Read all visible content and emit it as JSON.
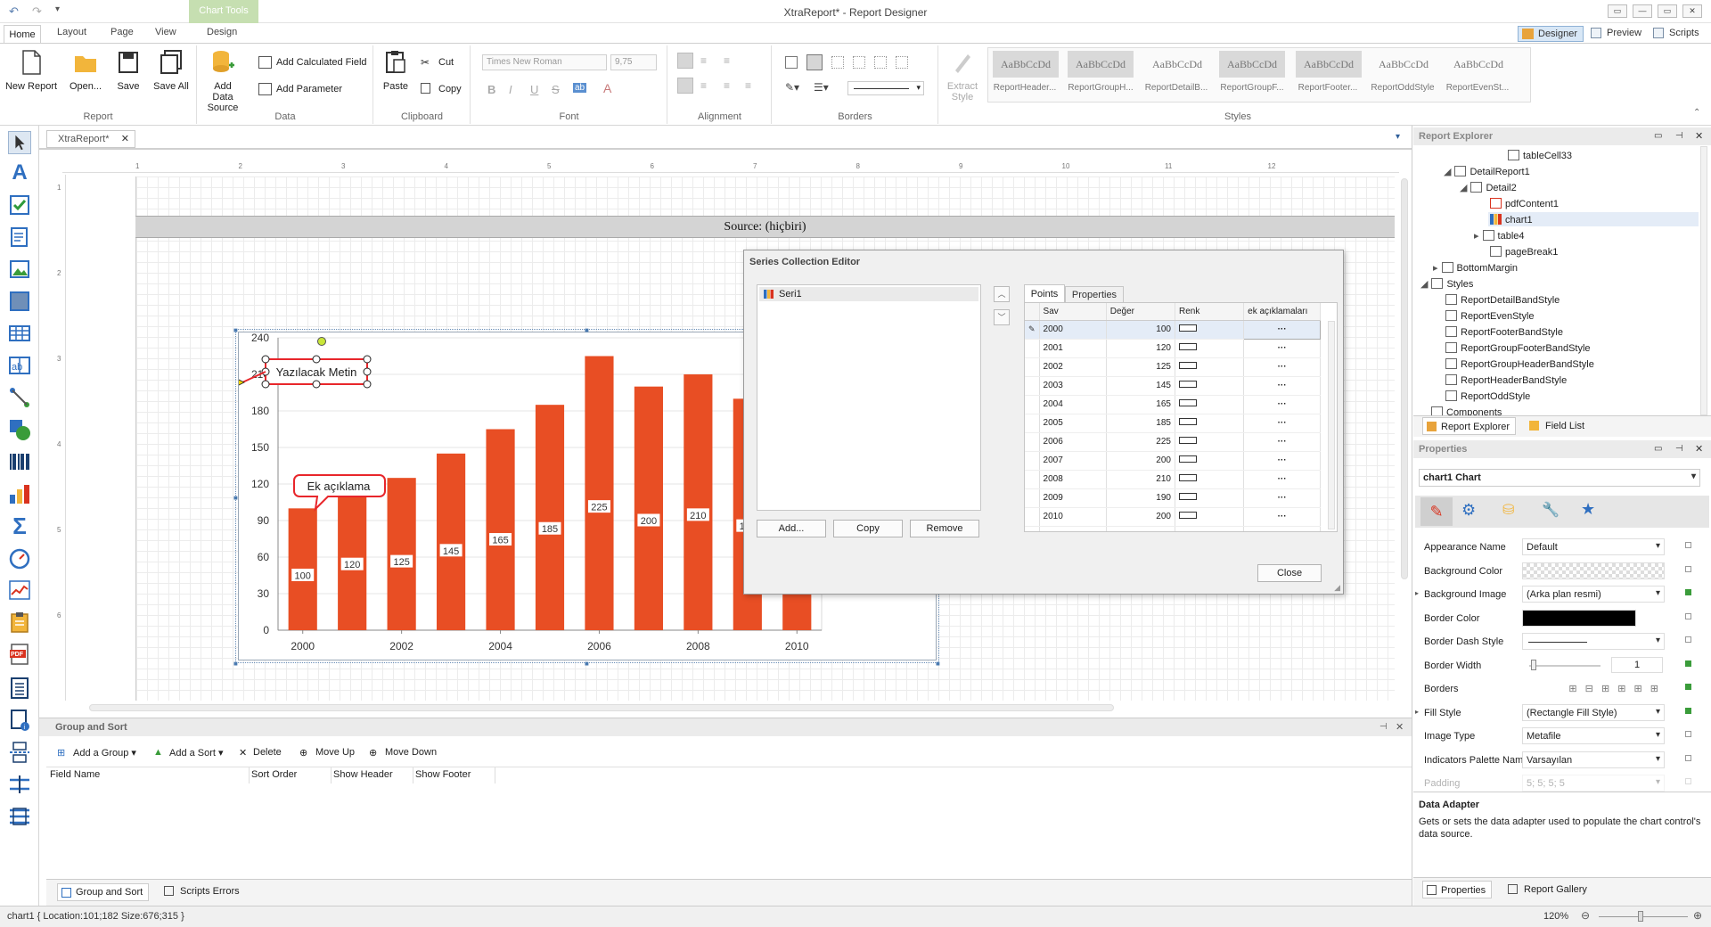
{
  "window": {
    "title": "XtraReport* - Report Designer",
    "contextual_tab": "Chart Tools",
    "controls": [
      "—",
      "▭",
      "▭",
      "✕"
    ]
  },
  "tabs": [
    "Home",
    "Layout",
    "Page",
    "View",
    "Design"
  ],
  "view_buttons": {
    "designer": "Designer",
    "preview": "Preview",
    "scripts": "Scripts"
  },
  "ribbon": {
    "report": {
      "caption": "Report",
      "new": "New Report",
      "open": "Open...",
      "save": "Save",
      "save_all": "Save All"
    },
    "data": {
      "caption": "Data",
      "add_data_source": "Add Data Source",
      "add_calculated": "Add Calculated Field",
      "add_parameter": "Add Parameter"
    },
    "clipboard": {
      "caption": "Clipboard",
      "paste": "Paste",
      "cut": "Cut",
      "copy": "Copy"
    },
    "font": {
      "caption": "Font",
      "family": "Times New Roman",
      "size": "9,75",
      "b": "B",
      "i": "I",
      "u": "U",
      "s": "S",
      "ab": "ab",
      "a": "A"
    },
    "alignment": {
      "caption": "Alignment"
    },
    "borders": {
      "caption": "Borders"
    },
    "styles": {
      "caption": "Styles",
      "extract": "Extract Style",
      "sample": "AaBbCcDd",
      "names": [
        "ReportHeader...",
        "ReportGroupH...",
        "ReportDetailB...",
        "ReportGroupF...",
        "ReportFooter...",
        "ReportOddStyle",
        "ReportEvenSt..."
      ]
    }
  },
  "document_tab": "XtraReport*",
  "ruler_numbers": [
    "1",
    "2",
    "3",
    "4",
    "5",
    "6",
    "7",
    "8",
    "9",
    "10",
    "11",
    "12"
  ],
  "vruler_numbers": [
    "1",
    "2",
    "3",
    "4",
    "5",
    "6"
  ],
  "source_label": "Source: (hiçbiri)",
  "chart_data": {
    "type": "bar",
    "categories": [
      "2000",
      "2001",
      "2002",
      "2003",
      "2004",
      "2005",
      "2006",
      "2007",
      "2008",
      "2009",
      "2010"
    ],
    "series": [
      {
        "name": "Seri1",
        "values": [
          100,
          120,
          125,
          145,
          165,
          185,
          225,
          200,
          210,
          190,
          200
        ],
        "color": "#e84e24"
      }
    ],
    "xticks": [
      "2000",
      "2002",
      "2004",
      "2006",
      "2008",
      "2010"
    ],
    "yticks": [
      "0",
      "30",
      "60",
      "90",
      "120",
      "150",
      "180",
      "210",
      "240"
    ],
    "ylim": [
      0,
      240
    ],
    "annotations": {
      "text": "Yazılacak Metin",
      "callout": "Ek açıklama"
    },
    "colors": {
      "bar": "#e84e24",
      "label_border": "#e84e24"
    }
  },
  "series_editor": {
    "title": "Series Collection Editor",
    "series": [
      "Seri1"
    ],
    "tabs": [
      "Points",
      "Properties"
    ],
    "columns": [
      "Sav",
      "Değer",
      "Renk",
      "ek açıklamaları"
    ],
    "rows": [
      {
        "x": "2000",
        "v": "100",
        "e": "···"
      },
      {
        "x": "2001",
        "v": "120",
        "e": "···"
      },
      {
        "x": "2002",
        "v": "125",
        "e": "···"
      },
      {
        "x": "2003",
        "v": "145",
        "e": "···"
      },
      {
        "x": "2004",
        "v": "165",
        "e": "···"
      },
      {
        "x": "2005",
        "v": "185",
        "e": "···"
      },
      {
        "x": "2006",
        "v": "225",
        "e": "···"
      },
      {
        "x": "2007",
        "v": "200",
        "e": "···"
      },
      {
        "x": "2008",
        "v": "210",
        "e": "···"
      },
      {
        "x": "2009",
        "v": "190",
        "e": "···"
      },
      {
        "x": "2010",
        "v": "200",
        "e": "···"
      }
    ],
    "buttons": {
      "add": "Add...",
      "copy": "Copy",
      "remove": "Remove",
      "close": "Close"
    }
  },
  "group_sort": {
    "title": "Group and Sort",
    "toolbar": {
      "add_group": "Add a Group ▾",
      "add_sort": "Add a Sort ▾",
      "delete": "Delete",
      "move_up": "Move Up",
      "move_down": "Move Down"
    },
    "columns": [
      "Field Name",
      "Sort Order",
      "Show Header",
      "Show Footer"
    ],
    "bottom_tabs": [
      "Group and Sort",
      "Scripts Errors"
    ]
  },
  "status": {
    "text": "chart1 { Location:101;182 Size:676;315 }",
    "zoom": "120%"
  },
  "report_explorer": {
    "title": "Report Explorer",
    "nodes": [
      "tableCell33",
      "DetailReport1",
      "Detail2",
      "pdfContent1",
      "chart1",
      "table4",
      "pageBreak1",
      "BottomMargin",
      "Styles",
      "ReportDetailBandStyle",
      "ReportEvenStyle",
      "ReportFooterBandStyle",
      "ReportGroupFooterBandStyle",
      "ReportGroupHeaderBandStyle",
      "ReportHeaderBandStyle",
      "ReportOddStyle",
      "Components"
    ],
    "tabs": [
      "Report Explorer",
      "Field List"
    ]
  },
  "properties": {
    "title": "Properties",
    "selector": "chart1  Chart",
    "rows": [
      {
        "name": "Appearance Name",
        "value": "Default"
      },
      {
        "name": "Background Color",
        "value": ""
      },
      {
        "name": "Background Image",
        "value": "(Arka plan resmi)"
      },
      {
        "name": "Border Color",
        "value": ""
      },
      {
        "name": "Border Dash Style",
        "value": ""
      },
      {
        "name": "Border Width",
        "value": "1"
      },
      {
        "name": "Borders",
        "value": ""
      },
      {
        "name": "Fill Style",
        "value": "(Rectangle Fill Style)"
      },
      {
        "name": "Image Type",
        "value": "Metafile"
      },
      {
        "name": "Indicators Palette Name",
        "value": "Varsayılan"
      },
      {
        "name": "Padding",
        "value": "5; 5; 5; 5"
      }
    ],
    "desc_title": "Data Adapter",
    "desc_text": "Gets or sets the data adapter used to populate the chart control's data source.",
    "tabs": [
      "Properties",
      "Report Gallery"
    ]
  }
}
